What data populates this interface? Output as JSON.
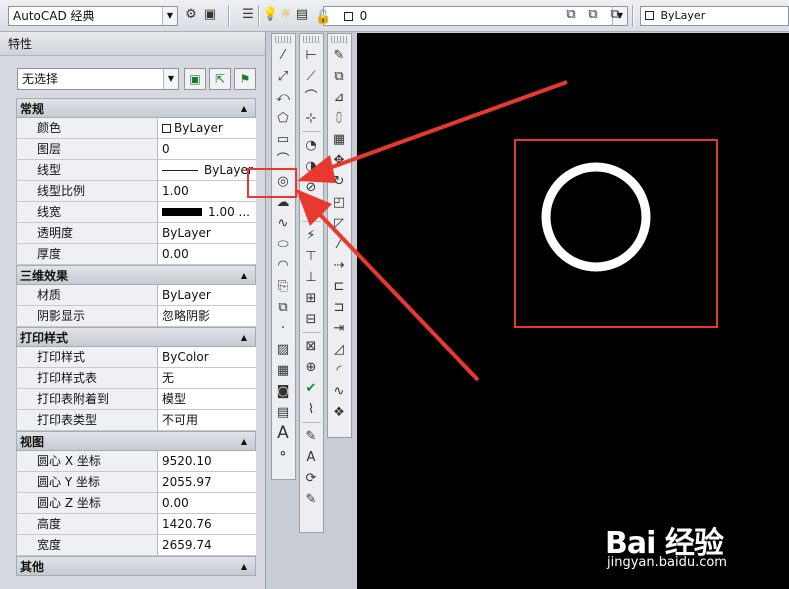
{
  "toolbar": {
    "workspace": "AutoCAD 经典",
    "layer_name": "0",
    "color_select": "ByLayer"
  },
  "properties": {
    "title": "特性",
    "selection": "无选择",
    "sections": [
      {
        "name": "常规",
        "rows": [
          {
            "label": "颜色",
            "value": "ByLayer"
          },
          {
            "label": "图层",
            "value": "0"
          },
          {
            "label": "线型",
            "value": "ByLayer"
          },
          {
            "label": "线型比例",
            "value": "1.00"
          },
          {
            "label": "线宽",
            "value": "1.00 ..."
          },
          {
            "label": "透明度",
            "value": "ByLayer"
          },
          {
            "label": "厚度",
            "value": "0.00"
          }
        ]
      },
      {
        "name": "三维效果",
        "rows": [
          {
            "label": "材质",
            "value": "ByLayer"
          },
          {
            "label": "阴影显示",
            "value": "忽略阴影"
          }
        ]
      },
      {
        "name": "打印样式",
        "rows": [
          {
            "label": "打印样式",
            "value": "ByColor"
          },
          {
            "label": "打印样式表",
            "value": "无"
          },
          {
            "label": "打印表附着到",
            "value": "模型"
          },
          {
            "label": "打印表类型",
            "value": "不可用"
          }
        ]
      },
      {
        "name": "视图",
        "rows": [
          {
            "label": "圆心 X 坐标",
            "value": "9520.10"
          },
          {
            "label": "圆心 Y 坐标",
            "value": "2055.97"
          },
          {
            "label": "圆心 Z 坐标",
            "value": "0.00"
          },
          {
            "label": "高度",
            "value": "1420.76"
          },
          {
            "label": "宽度",
            "value": "2659.74"
          }
        ]
      },
      {
        "name": "其他",
        "rows": []
      }
    ]
  },
  "watermark": {
    "brand": "Bai 经验",
    "url": "jingyan.baidu.com"
  },
  "colors": {
    "annotation": "#e8382f",
    "canvas": "#000000"
  }
}
